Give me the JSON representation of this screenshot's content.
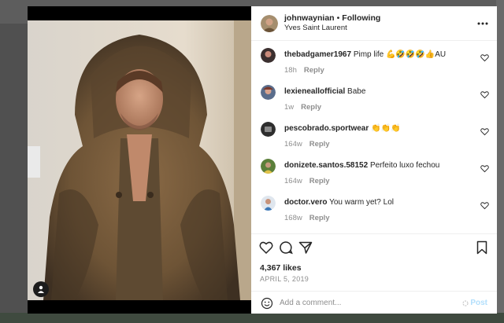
{
  "colors": {
    "accent": "#0095f6",
    "post_disabled": "#b2dffc",
    "text": "#262626",
    "muted": "#8e8e8e"
  },
  "header": {
    "username": "johnwaynian",
    "separator": "•",
    "follow_status": "Following",
    "location": "Yves Saint Laurent",
    "more_icon": "more-horizontal-icon"
  },
  "comments": [
    {
      "username": "thebadgamer1967",
      "text": "Pimp life 💪🤣🤣🤣👍AU",
      "time": "18h",
      "reply": "Reply"
    },
    {
      "username": "lexieneallofficial",
      "text": "Babe",
      "time": "1w",
      "reply": "Reply"
    },
    {
      "username": "pescobrado.sportwear",
      "text": "👏👏👏",
      "time": "164w",
      "reply": "Reply"
    },
    {
      "username": "donizete.santos.58152",
      "text": "Perfeito luxo fechou",
      "time": "164w",
      "reply": "Reply"
    },
    {
      "username": "doctor.vero",
      "text": "You warm yet? Lol",
      "time": "168w",
      "reply": "Reply"
    }
  ],
  "actions": {
    "likes": "4,367 likes",
    "date": "APRIL 5, 2019"
  },
  "add_comment": {
    "placeholder": "Add a comment...",
    "post_label": "Post"
  }
}
